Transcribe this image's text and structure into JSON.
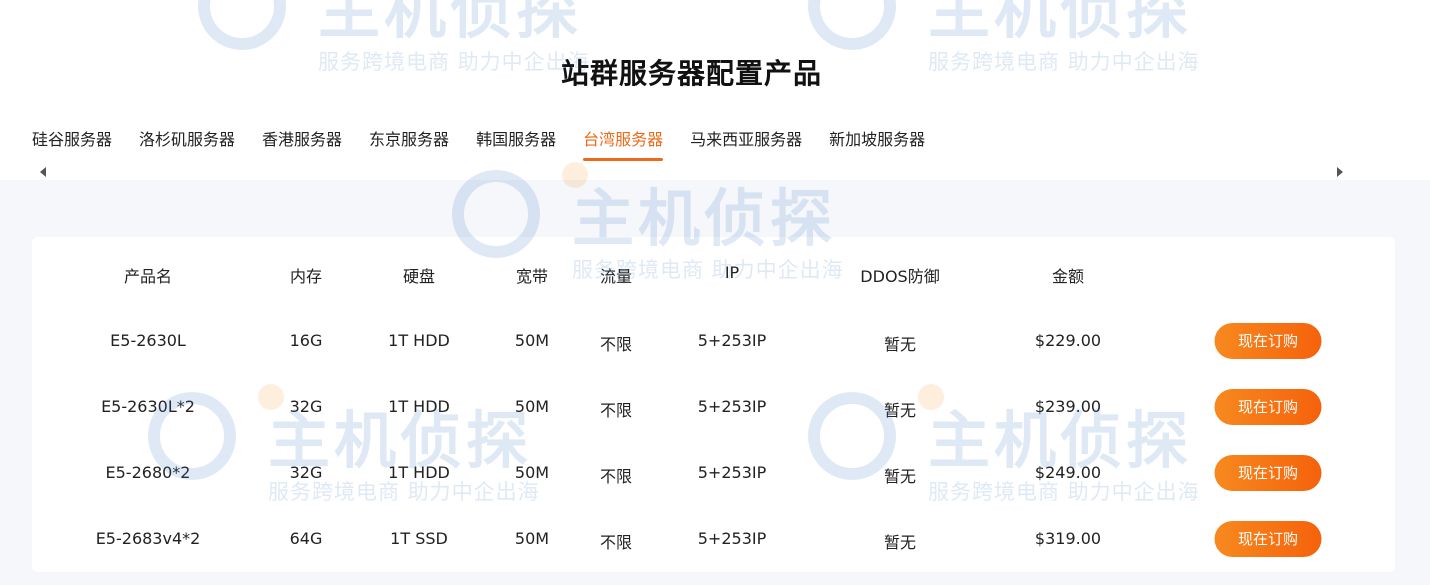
{
  "title": "站群服务器配置产品",
  "tabs": [
    {
      "label": "硅谷服务器"
    },
    {
      "label": "洛杉矶服务器"
    },
    {
      "label": "香港服务器"
    },
    {
      "label": "东京服务器"
    },
    {
      "label": "韩国服务器"
    },
    {
      "label": "台湾服务器",
      "active": true
    },
    {
      "label": "马来西亚服务器"
    },
    {
      "label": "新加坡服务器"
    }
  ],
  "table": {
    "headers": {
      "name": "产品名",
      "memory": "内存",
      "disk": "硬盘",
      "bandwidth": "宽带",
      "traffic": "流量",
      "ip": "IP",
      "ddos": "DDOS防御",
      "price": "金额"
    },
    "rows": [
      {
        "name": "E5-2630L",
        "memory": "16G",
        "disk": "1T HDD",
        "bandwidth": "50M",
        "traffic": "不限",
        "ip": "5+253IP",
        "ddos": "暂无",
        "price": "$229.00",
        "action": "现在订购"
      },
      {
        "name": "E5-2630L*2",
        "memory": "32G",
        "disk": "1T HDD",
        "bandwidth": "50M",
        "traffic": "不限",
        "ip": "5+253IP",
        "ddos": "暂无",
        "price": "$239.00",
        "action": "现在订购"
      },
      {
        "name": "E5-2680*2",
        "memory": "32G",
        "disk": "1T HDD",
        "bandwidth": "50M",
        "traffic": "不限",
        "ip": "5+253IP",
        "ddos": "暂无",
        "price": "$249.00",
        "action": "现在订购"
      },
      {
        "name": "E5-2683v4*2",
        "memory": "64G",
        "disk": "1T SSD",
        "bandwidth": "50M",
        "traffic": "不限",
        "ip": "5+253IP",
        "ddos": "暂无",
        "price": "$319.00",
        "action": "现在订购"
      }
    ]
  },
  "watermark": {
    "main": "主机侦探",
    "sub": "服务跨境电商 助力中企出海"
  },
  "colors": {
    "accent": "#ee6a1a",
    "button_start": "#f7891f",
    "button_end": "#f5620b",
    "panel_bg": "#f5f7fa"
  },
  "icons": {
    "scroll_left": "triangle-left-icon",
    "scroll_right": "triangle-right-icon"
  }
}
